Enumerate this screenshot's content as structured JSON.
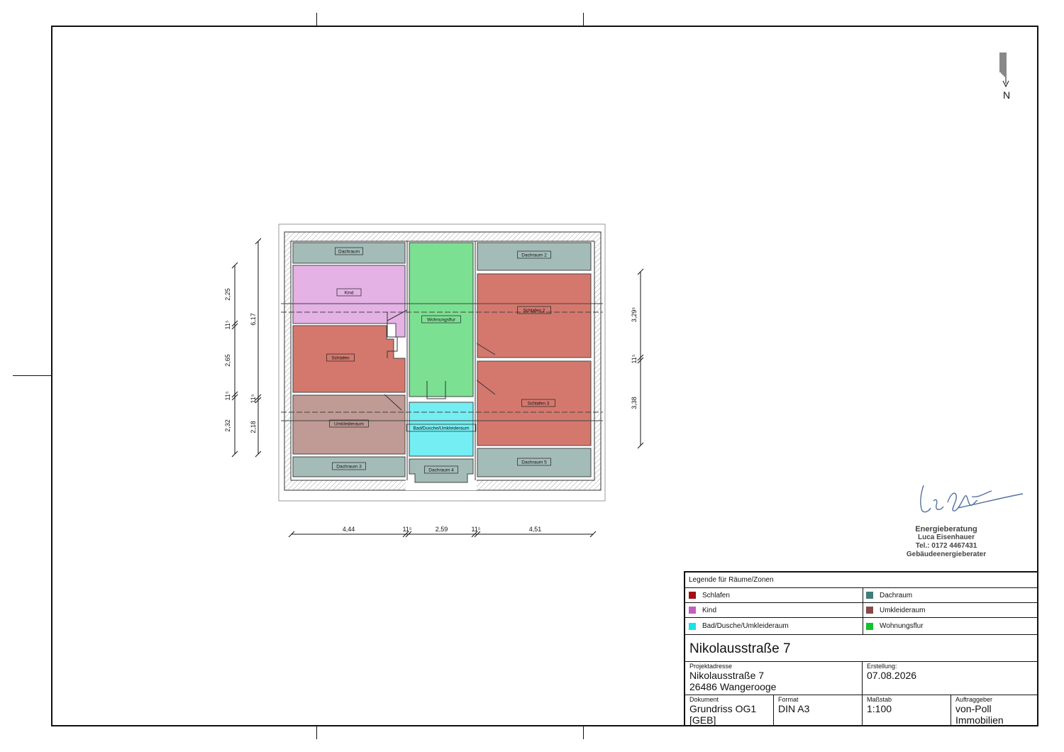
{
  "north": {
    "letter": "N"
  },
  "plan": {
    "rooms": [
      {
        "key": "dachraum",
        "label": "Dachraum",
        "color": "#a4bcb8"
      },
      {
        "key": "kind",
        "label": "Kind",
        "color": "#e4b2e4"
      },
      {
        "key": "schlafen",
        "label": "Schlafen",
        "color": "#d4786e"
      },
      {
        "key": "umkleideraum",
        "label": "Umkleideraum",
        "color": "#c09a95"
      },
      {
        "key": "dachraum3",
        "label": "Dachraum 3",
        "color": "#a4bcb8"
      },
      {
        "key": "wohnungsflur",
        "label": "Wohnungsflur",
        "color": "#7ce092"
      },
      {
        "key": "bad",
        "label": "Bad/Dusche/Umkleideraum",
        "color": "#74eef2"
      },
      {
        "key": "dachraum4",
        "label": "Dachraum 4",
        "color": "#a4bcb8"
      },
      {
        "key": "dachraum2",
        "label": "Dachraum 2",
        "color": "#a4bcb8"
      },
      {
        "key": "schlafen2",
        "label": "Schlafen 2",
        "color": "#d4786e"
      },
      {
        "key": "schlafen3",
        "label": "Schlafen 3",
        "color": "#d4786e"
      },
      {
        "key": "dachraum5",
        "label": "Dachraum 5",
        "color": "#a4bcb8"
      }
    ],
    "dimensions": {
      "left_outer": [
        "2,25",
        "11⁵",
        "2,65",
        "11⁵",
        "2,32"
      ],
      "left_inner": [
        "6,17",
        "11⁵",
        "2,18"
      ],
      "right": [
        "3,29⁵",
        "11⁵",
        "3,38"
      ],
      "bottom": [
        "4,44",
        "11⁵",
        "2,59",
        "11⁵",
        "4,51"
      ]
    }
  },
  "signature": {
    "line1": "Energieberatung",
    "line2": "Luca Eisenhauer",
    "line3": "Tel.: 0172 4467431",
    "line4": "Gebäudeenergieberater"
  },
  "legend": {
    "title": "Legende für Räume/Zonen",
    "items": [
      {
        "label": "Schlafen",
        "color": "#a30f0f"
      },
      {
        "label": "Dachraum",
        "color": "#3f7d78"
      },
      {
        "label": "Kind",
        "color": "#c25ec2"
      },
      {
        "label": "Umkleideraum",
        "color": "#874a47"
      },
      {
        "label": "Bad/Dusche/Umkleideraum",
        "color": "#17e3ea"
      },
      {
        "label": "Wohnungsflur",
        "color": "#13c22c"
      }
    ]
  },
  "titleblock": {
    "title": "Nikolausstraße 7",
    "projektadresse_label": "Projektadresse",
    "address_line1": "Nikolausstraße  7",
    "address_line2": "26486 Wangerooge",
    "erstellung_label": "Erstellung:",
    "erstellung_value": "07.08.2026",
    "dokument_label": "Dokument",
    "dokument_line1": "Grundriss OG1",
    "dokument_line2": "[GEB]",
    "format_label": "Format",
    "format_value": "DIN A3",
    "massstab_label": "Maßstab",
    "massstab_value": "1:100",
    "auftraggeber_label": "Auftraggeber",
    "auftraggeber_line1": "von-Poll",
    "auftraggeber_line2": "Immobilien"
  }
}
